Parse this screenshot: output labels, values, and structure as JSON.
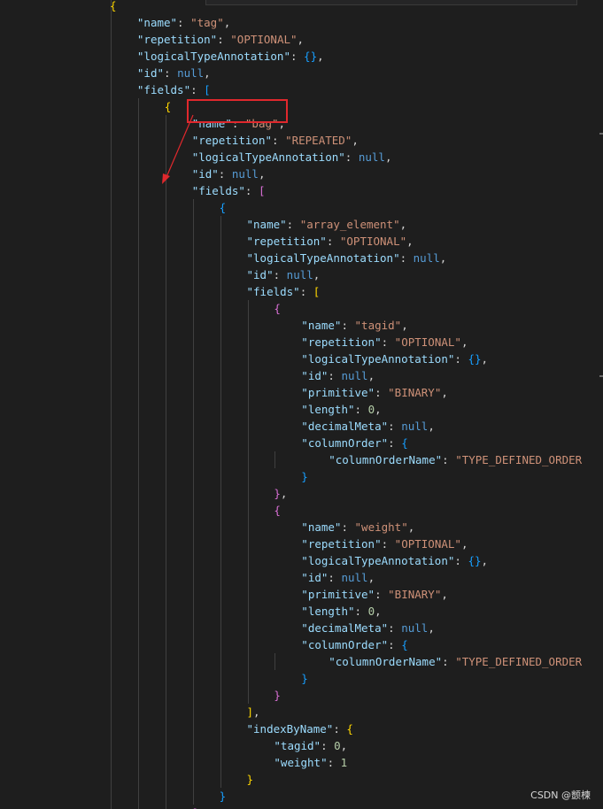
{
  "editor": {
    "lines": [
      [
        [
          "b1",
          "{"
        ]
      ],
      [
        [
          "k",
          "\"name\""
        ],
        [
          "p",
          ": "
        ],
        [
          "s",
          "\"tag\""
        ],
        [
          "p",
          ","
        ]
      ],
      [
        [
          "k",
          "\"repetition\""
        ],
        [
          "p",
          ": "
        ],
        [
          "s",
          "\"OPTIONAL\""
        ],
        [
          "p",
          ","
        ]
      ],
      [
        [
          "k",
          "\"logicalTypeAnnotation\""
        ],
        [
          "p",
          ": "
        ],
        [
          "b3",
          "{}"
        ],
        [
          "p",
          ","
        ]
      ],
      [
        [
          "k",
          "\"id\""
        ],
        [
          "p",
          ": "
        ],
        [
          "c",
          "null"
        ],
        [
          "p",
          ","
        ]
      ],
      [
        [
          "k",
          "\"fields\""
        ],
        [
          "p",
          ": "
        ],
        [
          "b3",
          "["
        ]
      ],
      [
        [
          "b1",
          "{"
        ]
      ],
      [
        [
          "k",
          "\"name\""
        ],
        [
          "p",
          ": "
        ],
        [
          "s",
          "\"bag\""
        ],
        [
          "p",
          ","
        ]
      ],
      [
        [
          "k",
          "\"repetition\""
        ],
        [
          "p",
          ": "
        ],
        [
          "s",
          "\"REPEATED\""
        ],
        [
          "p",
          ","
        ]
      ],
      [
        [
          "k",
          "\"logicalTypeAnnotation\""
        ],
        [
          "p",
          ": "
        ],
        [
          "c",
          "null"
        ],
        [
          "p",
          ","
        ]
      ],
      [
        [
          "k",
          "\"id\""
        ],
        [
          "p",
          ": "
        ],
        [
          "c",
          "null"
        ],
        [
          "p",
          ","
        ]
      ],
      [
        [
          "k",
          "\"fields\""
        ],
        [
          "p",
          ": "
        ],
        [
          "b2",
          "["
        ]
      ],
      [
        [
          "b3",
          "{"
        ]
      ],
      [
        [
          "k",
          "\"name\""
        ],
        [
          "p",
          ": "
        ],
        [
          "s",
          "\"array_element\""
        ],
        [
          "p",
          ","
        ]
      ],
      [
        [
          "k",
          "\"repetition\""
        ],
        [
          "p",
          ": "
        ],
        [
          "s",
          "\"OPTIONAL\""
        ],
        [
          "p",
          ","
        ]
      ],
      [
        [
          "k",
          "\"logicalTypeAnnotation\""
        ],
        [
          "p",
          ": "
        ],
        [
          "c",
          "null"
        ],
        [
          "p",
          ","
        ]
      ],
      [
        [
          "k",
          "\"id\""
        ],
        [
          "p",
          ": "
        ],
        [
          "c",
          "null"
        ],
        [
          "p",
          ","
        ]
      ],
      [
        [
          "k",
          "\"fields\""
        ],
        [
          "p",
          ": "
        ],
        [
          "b1",
          "["
        ]
      ],
      [
        [
          "b2",
          "{"
        ]
      ],
      [
        [
          "k",
          "\"name\""
        ],
        [
          "p",
          ": "
        ],
        [
          "s",
          "\"tagid\""
        ],
        [
          "p",
          ","
        ]
      ],
      [
        [
          "k",
          "\"repetition\""
        ],
        [
          "p",
          ": "
        ],
        [
          "s",
          "\"OPTIONAL\""
        ],
        [
          "p",
          ","
        ]
      ],
      [
        [
          "k",
          "\"logicalTypeAnnotation\""
        ],
        [
          "p",
          ": "
        ],
        [
          "b3",
          "{}"
        ],
        [
          "p",
          ","
        ]
      ],
      [
        [
          "k",
          "\"id\""
        ],
        [
          "p",
          ": "
        ],
        [
          "c",
          "null"
        ],
        [
          "p",
          ","
        ]
      ],
      [
        [
          "k",
          "\"primitive\""
        ],
        [
          "p",
          ": "
        ],
        [
          "s",
          "\"BINARY\""
        ],
        [
          "p",
          ","
        ]
      ],
      [
        [
          "k",
          "\"length\""
        ],
        [
          "p",
          ": "
        ],
        [
          "n",
          "0"
        ],
        [
          "p",
          ","
        ]
      ],
      [
        [
          "k",
          "\"decimalMeta\""
        ],
        [
          "p",
          ": "
        ],
        [
          "c",
          "null"
        ],
        [
          "p",
          ","
        ]
      ],
      [
        [
          "k",
          "\"columnOrder\""
        ],
        [
          "p",
          ": "
        ],
        [
          "b3",
          "{"
        ]
      ],
      [
        [
          "k",
          "\"columnOrderName\""
        ],
        [
          "p",
          ": "
        ],
        [
          "s",
          "\"TYPE_DEFINED_ORDER"
        ]
      ],
      [
        [
          "b3",
          "}"
        ]
      ],
      [
        [
          "b2",
          "}"
        ],
        [
          "p",
          ","
        ]
      ],
      [
        [
          "b2",
          "{"
        ]
      ],
      [
        [
          "k",
          "\"name\""
        ],
        [
          "p",
          ": "
        ],
        [
          "s",
          "\"weight\""
        ],
        [
          "p",
          ","
        ]
      ],
      [
        [
          "k",
          "\"repetition\""
        ],
        [
          "p",
          ": "
        ],
        [
          "s",
          "\"OPTIONAL\""
        ],
        [
          "p",
          ","
        ]
      ],
      [
        [
          "k",
          "\"logicalTypeAnnotation\""
        ],
        [
          "p",
          ": "
        ],
        [
          "b3",
          "{}"
        ],
        [
          "p",
          ","
        ]
      ],
      [
        [
          "k",
          "\"id\""
        ],
        [
          "p",
          ": "
        ],
        [
          "c",
          "null"
        ],
        [
          "p",
          ","
        ]
      ],
      [
        [
          "k",
          "\"primitive\""
        ],
        [
          "p",
          ": "
        ],
        [
          "s",
          "\"BINARY\""
        ],
        [
          "p",
          ","
        ]
      ],
      [
        [
          "k",
          "\"length\""
        ],
        [
          "p",
          ": "
        ],
        [
          "n",
          "0"
        ],
        [
          "p",
          ","
        ]
      ],
      [
        [
          "k",
          "\"decimalMeta\""
        ],
        [
          "p",
          ": "
        ],
        [
          "c",
          "null"
        ],
        [
          "p",
          ","
        ]
      ],
      [
        [
          "k",
          "\"columnOrder\""
        ],
        [
          "p",
          ": "
        ],
        [
          "b3",
          "{"
        ]
      ],
      [
        [
          "k",
          "\"columnOrderName\""
        ],
        [
          "p",
          ": "
        ],
        [
          "s",
          "\"TYPE_DEFINED_ORDER"
        ]
      ],
      [
        [
          "b3",
          "}"
        ]
      ],
      [
        [
          "b2",
          "}"
        ]
      ],
      [
        [
          "b1",
          "]"
        ],
        [
          "p",
          ","
        ]
      ],
      [
        [
          "k",
          "\"indexByName\""
        ],
        [
          "p",
          ": "
        ],
        [
          "b1",
          "{"
        ]
      ],
      [
        [
          "k",
          "\"tagid\""
        ],
        [
          "p",
          ": "
        ],
        [
          "n",
          "0"
        ],
        [
          "p",
          ","
        ]
      ],
      [
        [
          "k",
          "\"weight\""
        ],
        [
          "p",
          ": "
        ],
        [
          "n",
          "1"
        ]
      ],
      [
        [
          "b1",
          "}"
        ]
      ],
      [
        [
          "b3",
          "}"
        ]
      ],
      [
        [
          "b2",
          "]"
        ],
        [
          "p",
          ","
        ]
      ]
    ]
  },
  "annotation": {
    "highlight_color": "#e0282d"
  },
  "watermark": {
    "text": "CSDN @颤楝"
  }
}
